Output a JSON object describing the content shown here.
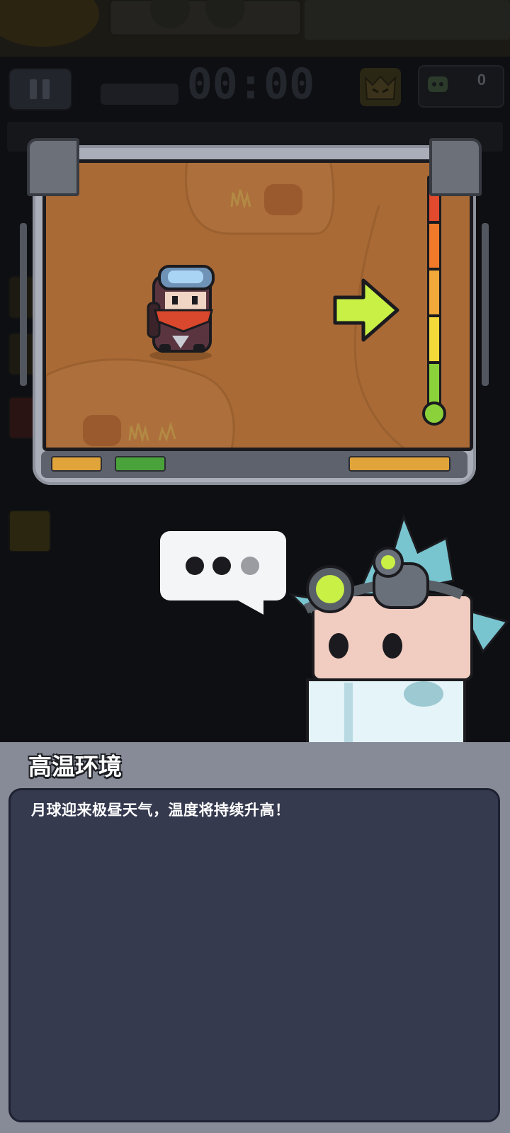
{
  "hud": {
    "timer": "00:00",
    "kill_count": "0",
    "pause_icon": "pause-icon",
    "boss_icon": "boss-face-icon",
    "kill_icon": "skull-icon"
  },
  "monitor": {
    "player_icon": "player-character",
    "direction_icon": "arrow-right-icon",
    "thermometer_icon": "thermometer-icon",
    "thermometer_level": 0.15,
    "colors": {
      "ground": "#a96a36",
      "arrow": "#c8f045",
      "thermo": [
        "#e24a2e",
        "#f07a2a",
        "#f2a93a",
        "#f3da3a",
        "#8bd23a"
      ]
    }
  },
  "speech_bubble": {
    "icon": "typing-dots-icon"
  },
  "scientist": {
    "icon": "scientist-character"
  },
  "tutorial": {
    "title": "高温环境",
    "message": "月球迎来极昼天气，温度将持续升高！"
  }
}
